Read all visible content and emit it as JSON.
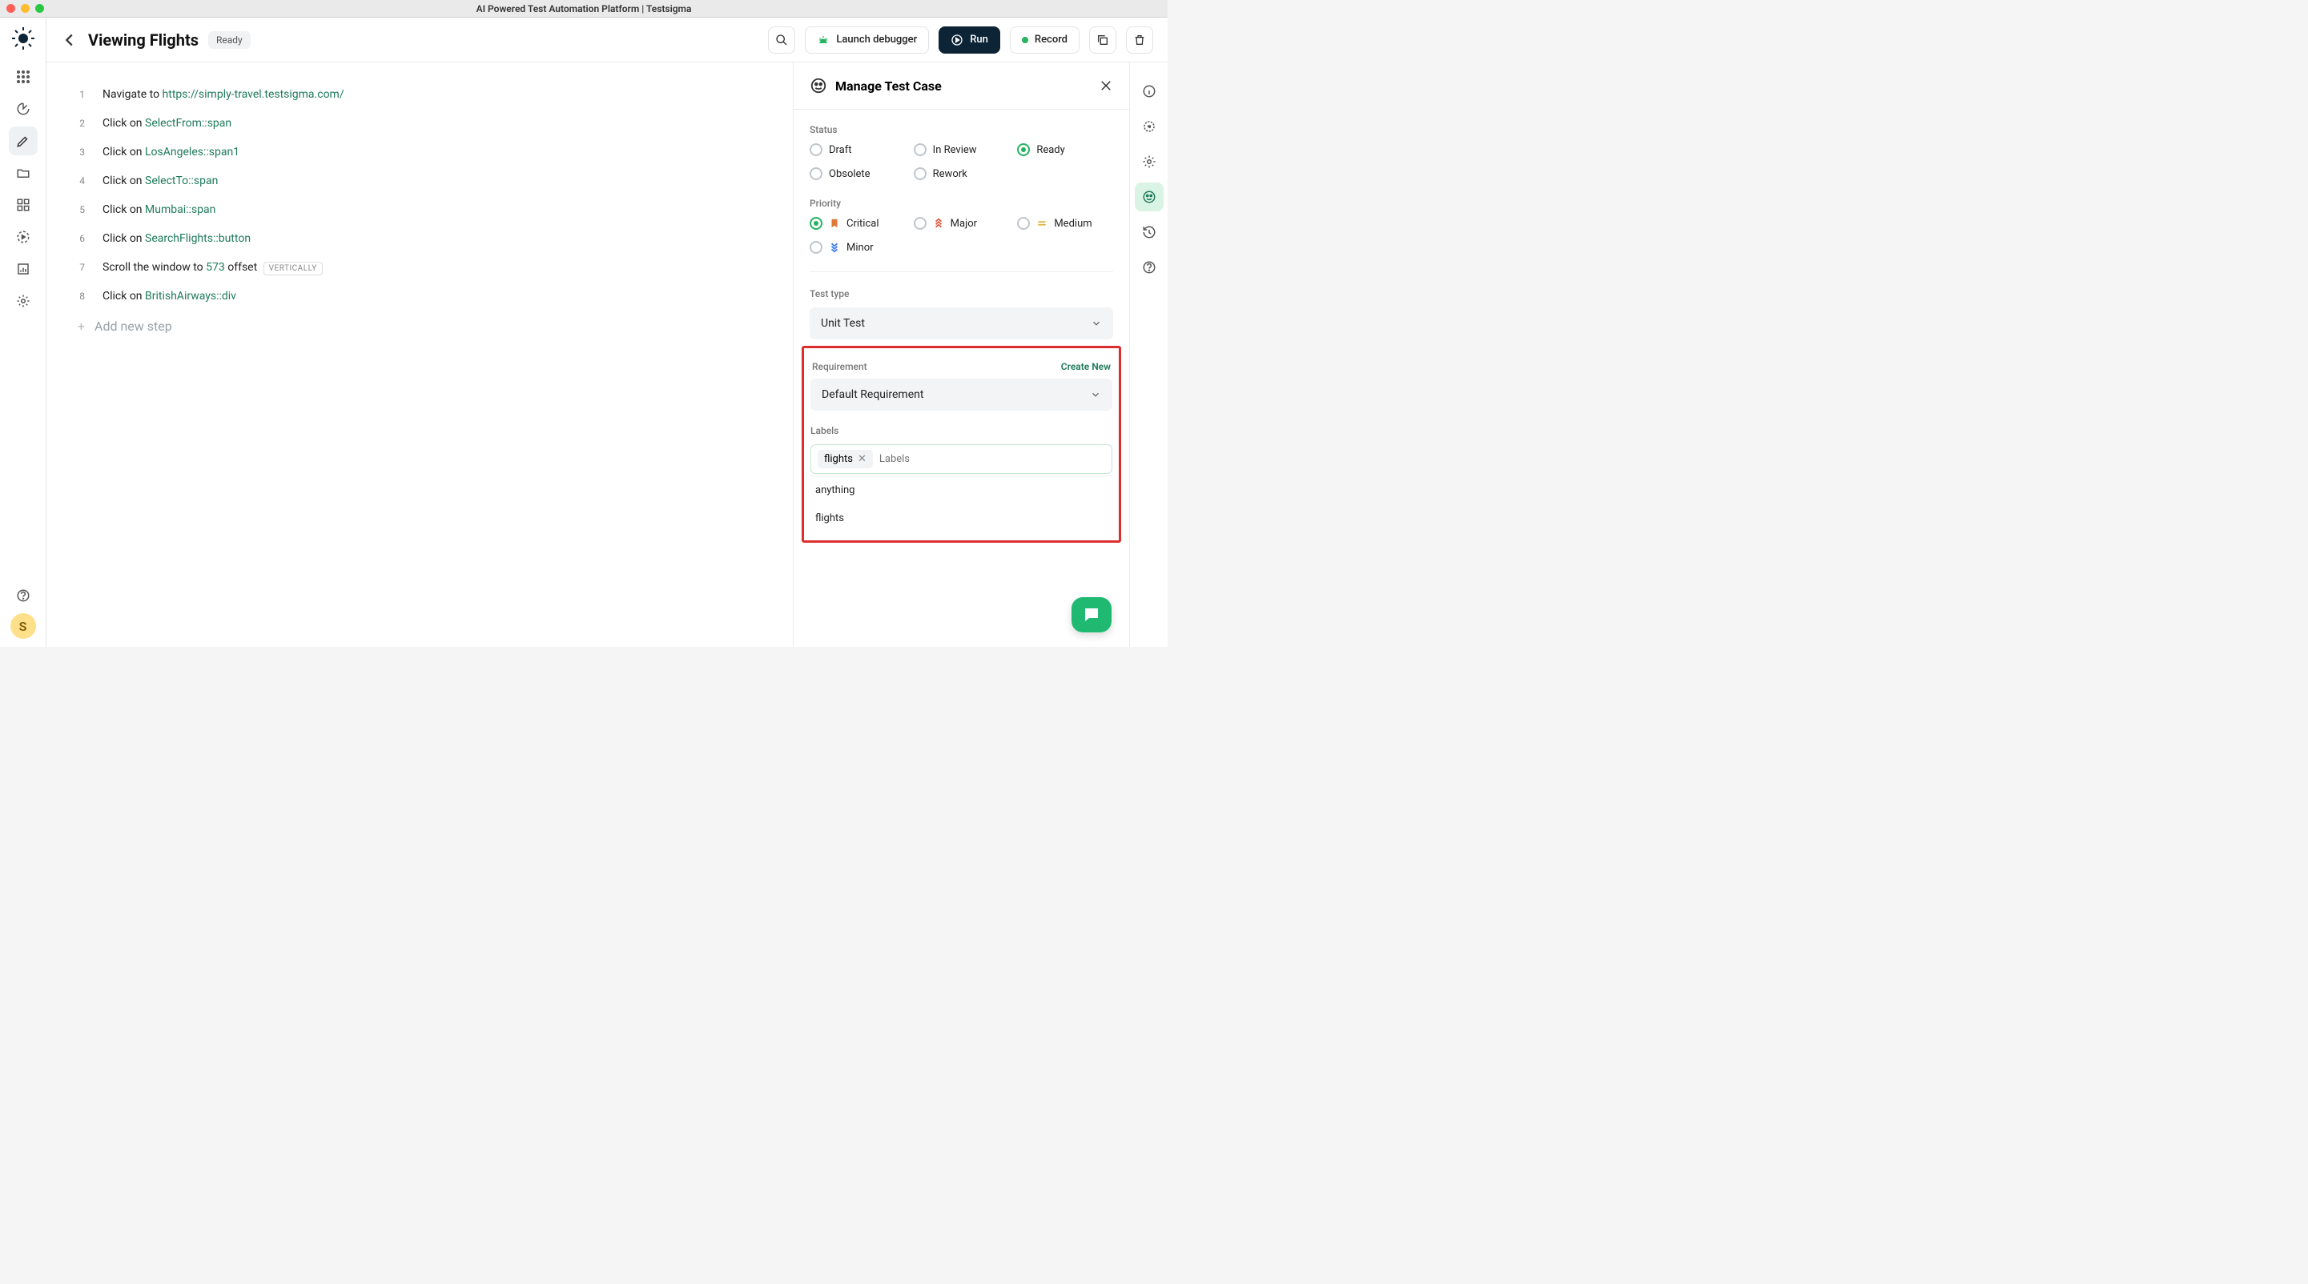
{
  "window_title": "AI Powered Test Automation Platform | Testsigma",
  "header": {
    "title": "Viewing Flights",
    "status_pill": "Ready",
    "launch_debugger": "Launch debugger",
    "run": "Run",
    "record": "Record"
  },
  "avatar_initial": "S",
  "steps": [
    {
      "num": "1",
      "prefix": "Navigate to ",
      "link": "https://simply-travel.testsigma.com/"
    },
    {
      "num": "2",
      "prefix": "Click on ",
      "link": "SelectFrom::span"
    },
    {
      "num": "3",
      "prefix": "Click on ",
      "link": "LosAngeles::span1"
    },
    {
      "num": "4",
      "prefix": "Click on ",
      "link": "SelectTo::span"
    },
    {
      "num": "5",
      "prefix": "Click on ",
      "link": "Mumbai::span"
    },
    {
      "num": "6",
      "prefix": "Click on ",
      "link": "SearchFlights::button"
    },
    {
      "num": "7",
      "prefix": "Scroll the window to ",
      "link": "573",
      "suffix": " offset ",
      "badge": "VERTICALLY"
    },
    {
      "num": "8",
      "prefix": "Click on ",
      "link": "BritishAirways::div"
    }
  ],
  "add_step_placeholder": "Add new step",
  "panel": {
    "title": "Manage Test Case",
    "status_label": "Status",
    "status_options": {
      "draft": "Draft",
      "in_review": "In Review",
      "ready": "Ready",
      "obsolete": "Obsolete",
      "rework": "Rework"
    },
    "status_selected": "ready",
    "priority_label": "Priority",
    "priority_options": {
      "critical": "Critical",
      "major": "Major",
      "medium": "Medium",
      "minor": "Minor"
    },
    "priority_selected": "critical",
    "test_type_label": "Test type",
    "test_type_value": "Unit Test",
    "requirement_label": "Requirement",
    "create_new": "Create New",
    "requirement_value": "Default Requirement",
    "labels_label": "Labels",
    "labels_chip": "flights",
    "labels_placeholder": "Labels",
    "labels_suggestions": [
      "anything",
      "flights"
    ]
  }
}
